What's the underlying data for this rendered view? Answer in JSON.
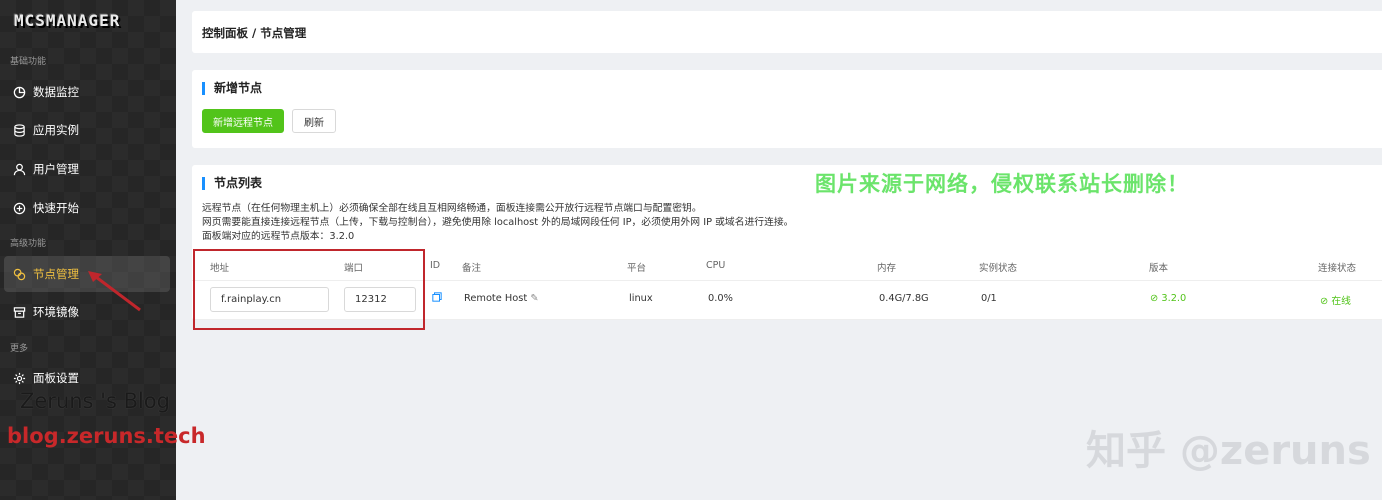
{
  "app": {
    "logo": "MCSMANAGER"
  },
  "sidebar": {
    "sections": {
      "basic": "基础功能",
      "advanced": "高级功能",
      "more": "更多"
    },
    "items": [
      {
        "label": "数据监控"
      },
      {
        "label": "应用实例"
      },
      {
        "label": "用户管理"
      },
      {
        "label": "快速开始"
      },
      {
        "label": "节点管理"
      },
      {
        "label": "环境镜像"
      },
      {
        "label": "面板设置"
      }
    ],
    "active_item": "节点管理"
  },
  "breadcrumb": "控制面板 / 节点管理",
  "new_node": {
    "title": "新增节点",
    "add_button": "新增远程节点",
    "refresh_button": "刷新"
  },
  "node_list": {
    "title": "节点列表",
    "desc": [
      "远程节点（在任何物理主机上）必须确保全部在线且互相网络畅通，面板连接需公开放行远程节点端口与配置密钥。",
      "网页需要能直接连接远程节点（上传，下载与控制台），避免使用除 localhost 外的局域网段任何 IP，必须使用外网 IP 或域名进行连接。",
      "面板端对应的远程节点版本：3.2.0"
    ],
    "columns": {
      "address": "地址",
      "port": "端口",
      "id": "ID",
      "remark": "备注",
      "platform": "平台",
      "cpu": "CPU",
      "memory": "内存",
      "instance_status": "实例状态",
      "version": "版本",
      "connection": "连接状态"
    },
    "rows": [
      {
        "address": "f.rainplay.cn",
        "port": "12312",
        "remark": "Remote Host",
        "platform": "linux",
        "cpu": "0.0%",
        "memory": "0.4G/7.8G",
        "instances": "0/1",
        "version": "3.2.0",
        "connection": "在线"
      }
    ]
  },
  "watermarks": {
    "notice": "图片来源于网络，侵权联系站长删除！",
    "blog_name": "Zeruns 's Blog",
    "blog_url": "blog.zeruns.tech",
    "zhihu": "知乎 @zeruns"
  },
  "colors": {
    "accent_green": "#52c41a",
    "title_bar": "#1890ff",
    "highlight": "#c0262c",
    "active_nav": "#f0c040"
  }
}
